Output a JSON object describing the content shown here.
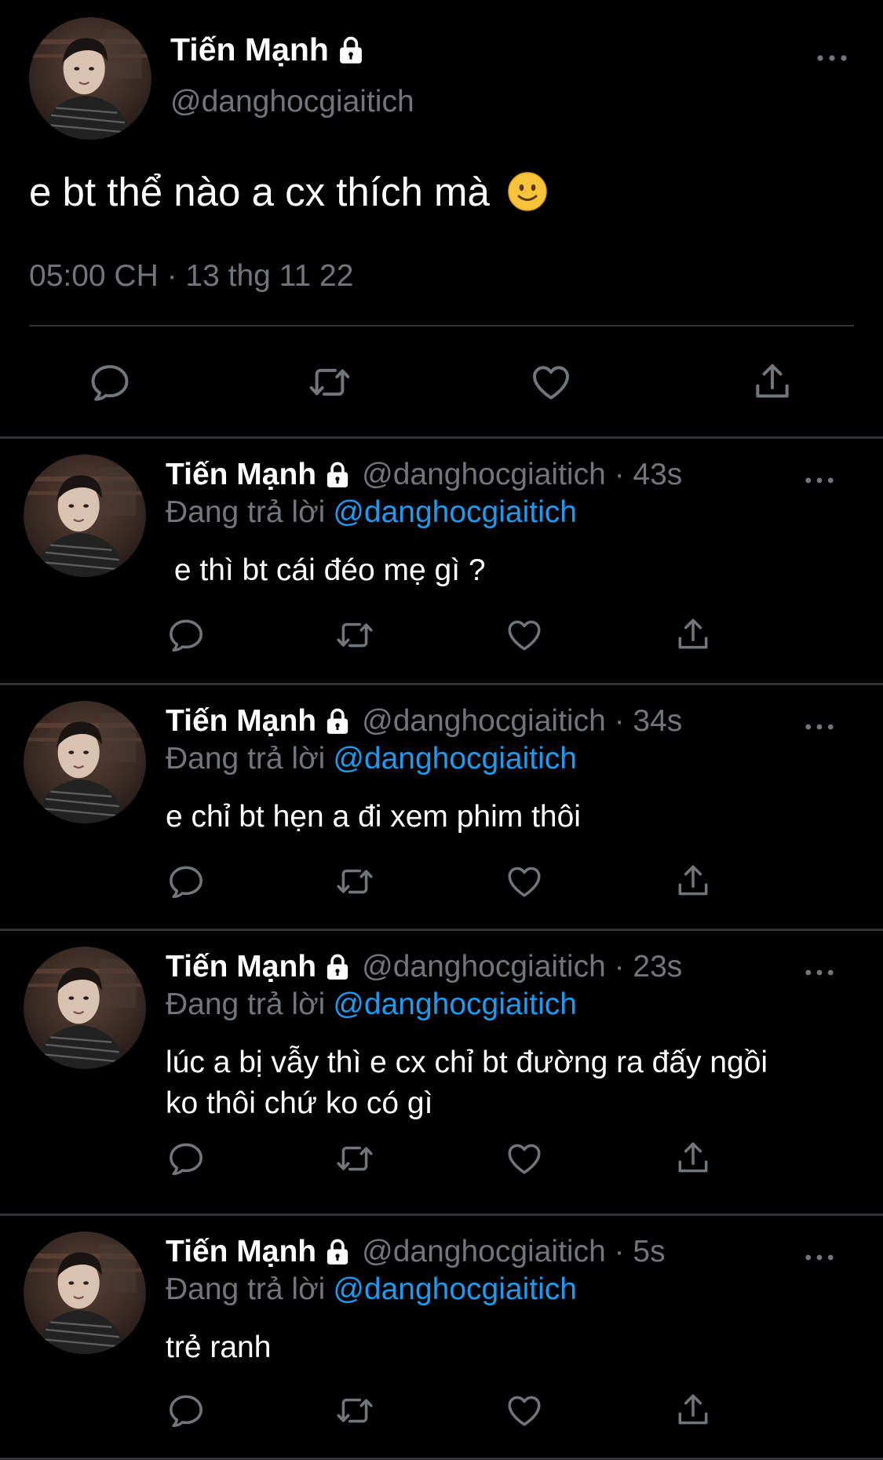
{
  "colors": {
    "background": "#000000",
    "text_primary": "#ffffff",
    "text_secondary": "#71767b",
    "mention": "#1d9bf0",
    "divider": "#2f3336"
  },
  "main_tweet": {
    "name": "Tiến Mạnh",
    "handle": "@danghocgiaitich",
    "text": "e bt thể nào a cx thích mà",
    "emoji": "slightly-smiling-face",
    "timestamp": "05:00 CH · 13 thg 11 22",
    "icons": [
      "lock-icon",
      "more-icon",
      "reply-icon",
      "retweet-icon",
      "like-icon",
      "share-icon"
    ]
  },
  "replies": [
    {
      "name": "Tiến Mạnh",
      "handle_time": "@danghocgiaitich · 43s",
      "replying_prefix": "Đang trả lời",
      "replying_to": "@danghocgiaitich",
      "text": " e thì bt cái đéo mẹ gì ?"
    },
    {
      "name": "Tiến Mạnh",
      "handle_time": "@danghocgiaitich · 34s",
      "replying_prefix": "Đang trả lời",
      "replying_to": "@danghocgiaitich",
      "text": "e chỉ bt hẹn a đi xem phim thôi"
    },
    {
      "name": "Tiến Mạnh",
      "handle_time": "@danghocgiaitich · 23s",
      "replying_prefix": "Đang trả lời",
      "replying_to": "@danghocgiaitich",
      "text": "lúc a bị vẫy thì e cx chỉ bt đường ra đấy ngồi ko thôi chứ ko có gì"
    },
    {
      "name": "Tiến Mạnh",
      "handle_time": "@danghocgiaitich · 5s",
      "replying_prefix": "Đang trả lời",
      "replying_to": "@danghocgiaitich",
      "text": "trẻ ranh"
    }
  ]
}
